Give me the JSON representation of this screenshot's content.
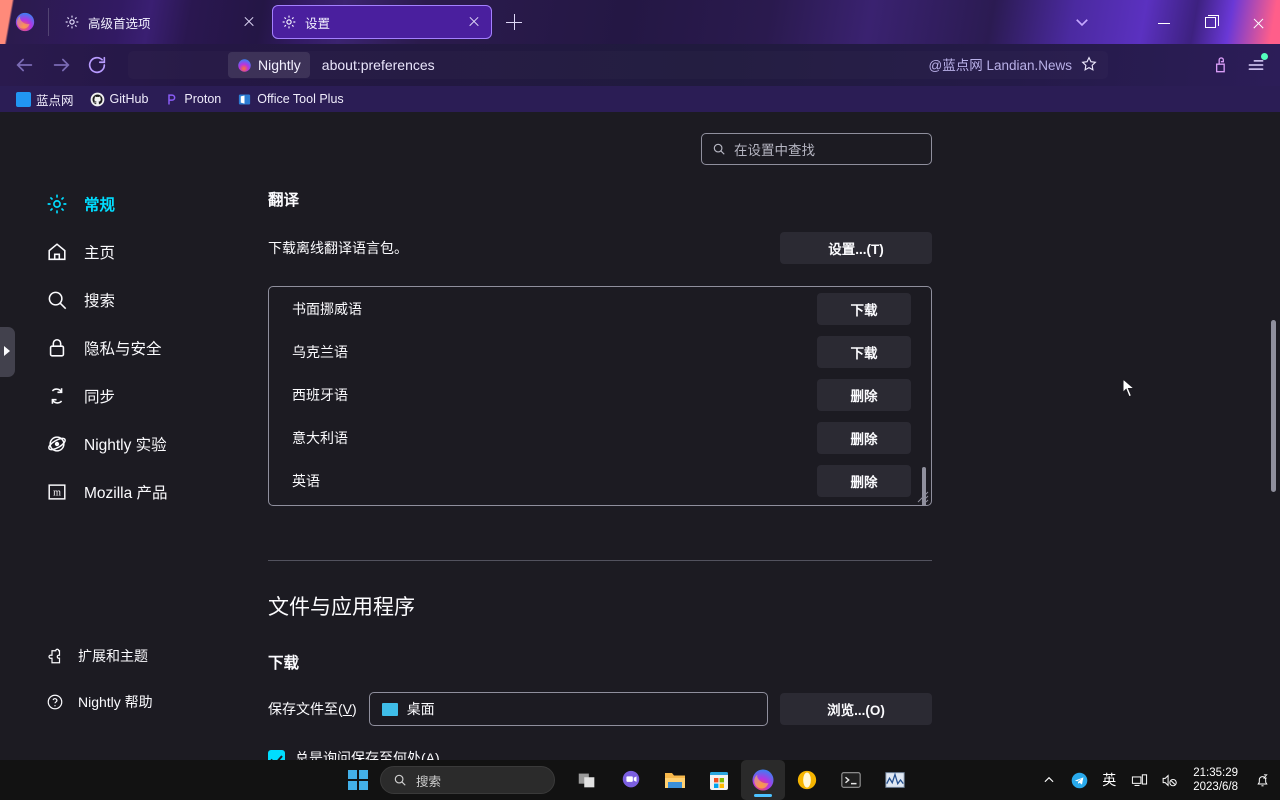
{
  "window": {
    "tabs": [
      {
        "icon": "gear-icon",
        "title": "高级首选项",
        "active": false
      },
      {
        "icon": "gear-icon",
        "title": "设置",
        "active": true
      }
    ],
    "new_tab_label": "+",
    "controls": {
      "list_all_tabs": "list-all-tabs",
      "minimize": "minimize",
      "maximize": "maximize",
      "close": "close"
    }
  },
  "navbar": {
    "back": "back",
    "forward": "forward",
    "reload": "reload",
    "identity_chip": "Nightly",
    "url": "about:preferences",
    "url_right_text": "@蓝点网 Landian.News",
    "bookmark_star": "star-icon",
    "share_icon": "share-icon",
    "menu_icon": "hamburger-menu-icon"
  },
  "bookmarks": [
    {
      "label": "蓝点网",
      "icon": "landian-icon"
    },
    {
      "label": "GitHub",
      "icon": "github-icon"
    },
    {
      "label": "Proton",
      "icon": "proton-icon"
    },
    {
      "label": "Office Tool Plus",
      "icon": "office-icon"
    }
  ],
  "search": {
    "placeholder": "在设置中查找",
    "value": ""
  },
  "sidebar": {
    "items": [
      {
        "label": "常规",
        "icon": "gear-icon",
        "selected": true
      },
      {
        "label": "主页",
        "icon": "home-icon",
        "selected": false
      },
      {
        "label": "搜索",
        "icon": "search-icon",
        "selected": false
      },
      {
        "label": "隐私与安全",
        "icon": "lock-icon",
        "selected": false
      },
      {
        "label": "同步",
        "icon": "sync-icon",
        "selected": false
      },
      {
        "label": "Nightly 实验",
        "icon": "atom-icon",
        "selected": false
      },
      {
        "label": "Mozilla 产品",
        "icon": "mozilla-icon",
        "selected": false
      }
    ],
    "bottom_items": [
      {
        "label": "扩展和主题",
        "icon": "puzzle-icon"
      },
      {
        "label": "Nightly 帮助",
        "icon": "question-icon"
      }
    ]
  },
  "translation": {
    "heading": "翻译",
    "description": "下载离线翻译语言包。",
    "settings_button": "设置...(T)",
    "languages": [
      {
        "name": "书面挪威语",
        "action": "下载"
      },
      {
        "name": "乌克兰语",
        "action": "下载"
      },
      {
        "name": "西班牙语",
        "action": "删除"
      },
      {
        "name": "意大利语",
        "action": "删除"
      },
      {
        "name": "英语",
        "action": "删除"
      }
    ]
  },
  "files_apps": {
    "heading": "文件与应用程序",
    "downloads_heading": "下载",
    "save_label": "保存文件至(V)",
    "save_label_plain": "保存文件至",
    "save_accel": "V",
    "path_value": "桌面",
    "browse_button": "浏览...(O)",
    "always_ask_label": "总是询问保存至何处(A)",
    "always_ask_plain": "总是询问保存至何处",
    "always_ask_accel": "A",
    "always_ask_checked": true
  },
  "taskbar": {
    "start": "start-icon",
    "search_placeholder": "搜索",
    "items": [
      {
        "name": "task-view-icon"
      },
      {
        "name": "chat-icon"
      },
      {
        "name": "file-explorer-icon"
      },
      {
        "name": "microsoft-store-icon"
      },
      {
        "name": "firefox-icon",
        "active": true
      },
      {
        "name": "opera-icon"
      },
      {
        "name": "terminal-icon"
      },
      {
        "name": "performance-monitor-icon"
      }
    ],
    "tray": {
      "chevron": "show-hidden-icons",
      "telegram": "telegram-icon",
      "ime": "英",
      "network": "network-icon",
      "volume": "volume-muted-icon",
      "time": "21:35:29",
      "date": "2023/6/8",
      "notifications": "notifications-icon"
    }
  },
  "colors": {
    "accent": "#00ddff",
    "page_bg": "#1c1b22",
    "button_bg": "#2b2a33",
    "tab_active": "#4a1f9e"
  }
}
